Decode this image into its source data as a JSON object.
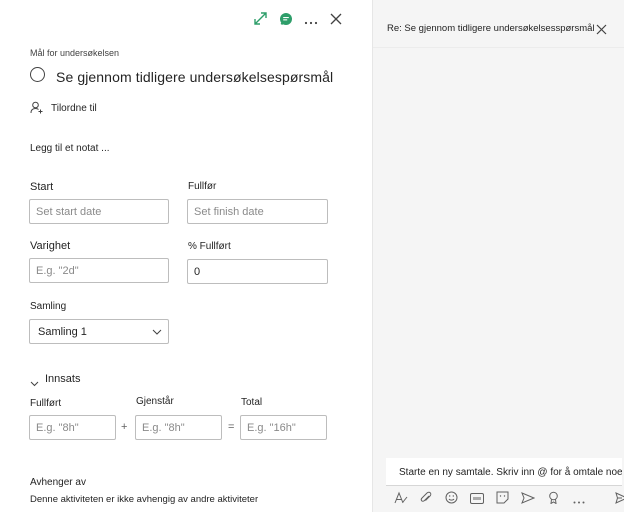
{
  "task": {
    "bucket_label": "Mål for undersøkelsen",
    "title": "Se gjennom tidligere undersøkelsespørsmål",
    "assign_label": "Tilordne til",
    "note_label": "Legg til et notat ..."
  },
  "dates": {
    "start_label": "Start",
    "start_placeholder": "Set start date",
    "finish_label": "Fullfør",
    "finish_placeholder": "Set finish date"
  },
  "progress": {
    "duration_label": "Varighet",
    "duration_placeholder": "E.g. \"2d\"",
    "percent_label": "% Fullført",
    "percent_value": "0"
  },
  "bucket": {
    "label": "Samling",
    "selected": "Samling 1"
  },
  "effort": {
    "section_label": "Innsats",
    "completed_label": "Fullført",
    "completed_placeholder": "E.g. \"8h\"",
    "remaining_label": "Gjenstår",
    "remaining_placeholder": "E.g. \"8h\"",
    "total_label": "Total",
    "total_placeholder": "E.g. \"16h\"",
    "plus": "+",
    "equals": "="
  },
  "dependencies": {
    "label": "Avhenger av",
    "text": "Denne aktiviteten er ikke avhengig av andre aktiviteter"
  },
  "conversation": {
    "title": "Re: Se gjennom tidligere undersøkelsesspørsmål",
    "compose_placeholder": "Starte en ny samtale. Skriv inn @ for å omtale noen."
  },
  "icons": {
    "expand": "expand-icon",
    "chat": "chat-icon",
    "more": "more-icon",
    "close": "close-icon",
    "person": "person-icon",
    "chevron": "chevron-down-icon"
  },
  "colors": {
    "accent_green": "#2e9e6a",
    "accent_purple": "#6b6fbf"
  }
}
